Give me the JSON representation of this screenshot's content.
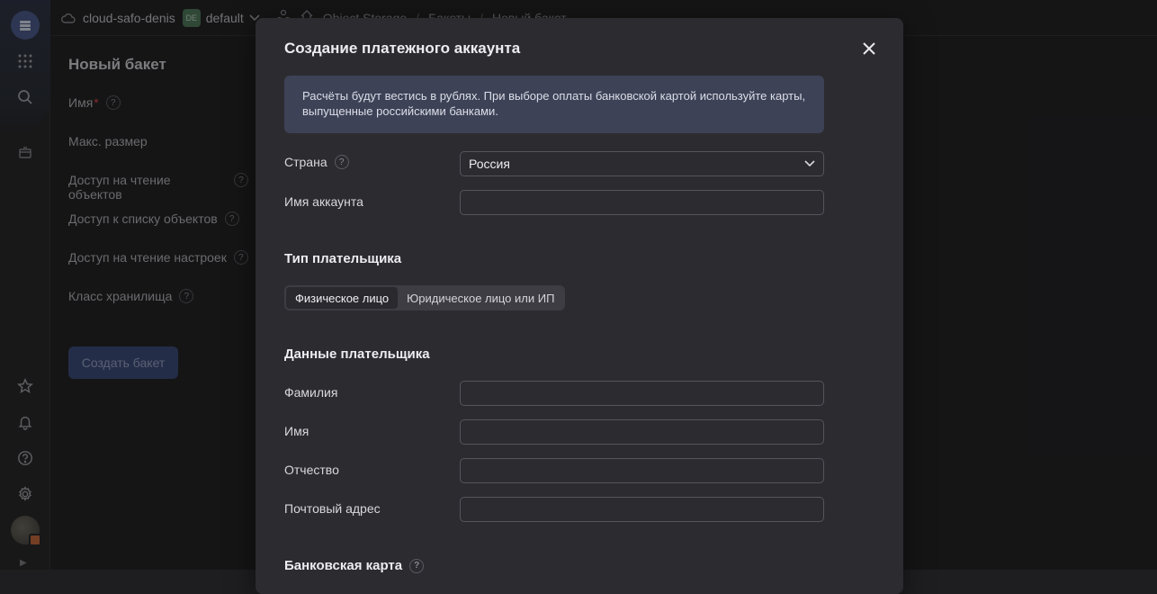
{
  "topbar": {
    "cloud_name": "cloud-safo-denis",
    "folder_badge": "DE",
    "folder_name": "default",
    "crumbs": [
      "Object Storage",
      "Бакеты",
      "Новый бакет"
    ]
  },
  "page": {
    "title": "Новый бакет",
    "fields": [
      "Имя",
      "Макс. размер",
      "Доступ на чтение объектов",
      "Доступ к списку объектов",
      "Доступ на чтение настроек",
      "Класс хранилища"
    ],
    "required_mark": "*",
    "create_button": "Создать бакет"
  },
  "modal": {
    "title": "Создание платежного аккаунта",
    "info": "Расчёты будут вестись в рублях. При выборе оплаты банковской картой используйте карты, выпущенные российскими банками.",
    "country_label": "Страна",
    "country_value": "Россия",
    "account_name_label": "Имя аккаунта",
    "payer_type_title": "Тип плательщика",
    "payer_types": [
      "Физическое лицо",
      "Юридическое лицо или ИП"
    ],
    "payer_data_title": "Данные плательщика",
    "last_name_label": "Фамилия",
    "first_name_label": "Имя",
    "middle_name_label": "Отчество",
    "postal_address_label": "Почтовый адрес",
    "bank_card_title": "Банковская карта"
  },
  "help_glyph": "?",
  "colors": {
    "accent": "#4a5a8c",
    "info_bg": "#3d4256",
    "modal_bg": "#2c2b30"
  }
}
